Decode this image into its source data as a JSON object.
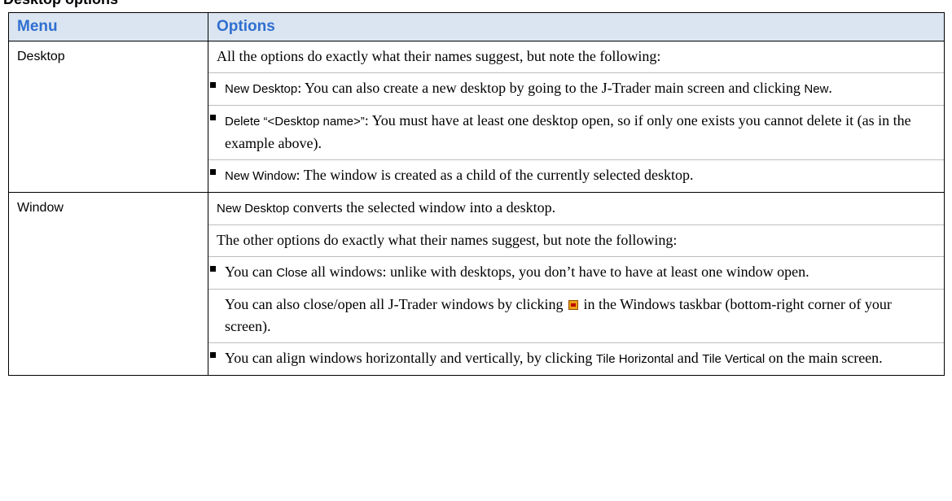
{
  "section_title": "Desktop options",
  "table": {
    "header_menu": "Menu",
    "header_options": "Options",
    "desktop": {
      "menu": "Desktop",
      "intro": "All the options do exactly what their names suggest, but note the following:",
      "b1_term1": "New Desktop",
      "b1_text1": ": You can also create a new desktop by going to the J-Trader main screen and clicking ",
      "b1_term2": "New",
      "b1_text2": ".",
      "b2_term1": "Delete “<Desktop name>”",
      "b2_text1": ": You must have at least one desktop open, so if only one exists you cannot delete it (as in the example above).",
      "b3_term1": "New Window",
      "b3_text1": ": The window is created as a child of the currently selected desktop."
    },
    "window": {
      "menu": "Window",
      "p1_term": "New Desktop",
      "p1_text": " converts the selected window into a desktop.",
      "p2": "The other options do exactly what their names suggest, but note the following:",
      "b1_text1": "You can ",
      "b1_term": "Close",
      "b1_text2": " all windows: unlike with desktops, you don’t have to have at least one window open.",
      "b1_sub_text1": "You can also close/open all J-Trader windows by clicking ",
      "b1_sub_icon": "jtrader-tray-icon",
      "b1_sub_text2": " in the Windows taskbar (bottom-right corner of your screen).",
      "b2_text1": "You can align windows horizontally and vertically, by clicking ",
      "b2_term1": "Tile Horizontal",
      "b2_text2": " and ",
      "b2_term2": "Tile Vertical",
      "b2_text3": " on the main screen."
    }
  }
}
